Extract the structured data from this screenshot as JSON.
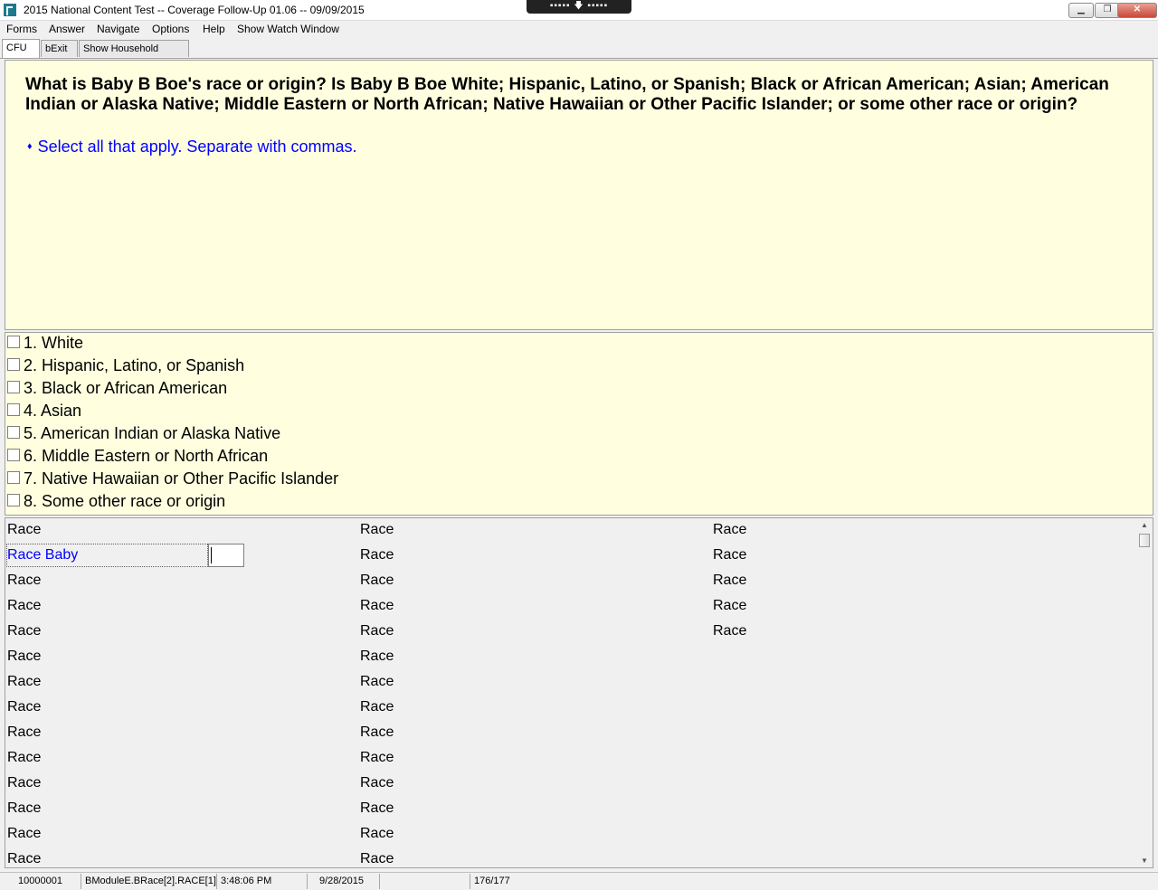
{
  "window": {
    "title": "2015 National Content Test -- Coverage Follow-Up 01.06 -- 09/09/2015",
    "toolbar_glyphs": "▪▪▪▪▪  🡇  ▪▪▪▪▪",
    "minimize_icon": "minimize-icon",
    "restore_icon": "restore-icon",
    "close_icon": "close-icon"
  },
  "menu": [
    "Forms",
    "Answer",
    "Navigate",
    "Options",
    "Help",
    "Show Watch Window"
  ],
  "tabs": [
    "CFU",
    "bExit",
    "Show Household Roster"
  ],
  "question": {
    "text": "What is Baby B Boe's race or origin? Is Baby B Boe White; Hispanic, Latino, or Spanish; Black or African American; Asian; American Indian or Alaska Native; Middle Eastern or North African; Native Hawaiian or Other Pacific Islander; or some other race or origin?",
    "bullet": "♦",
    "instruction": "Select all that apply. Separate with commas."
  },
  "options": [
    "1. White",
    "2. Hispanic, Latino, or Spanish",
    "3. Black or African American",
    "4. Asian",
    "5. American Indian or Alaska Native",
    "6. Middle Eastern or North African",
    "7. Native Hawaiian or Other Pacific Islander",
    "8. Some other race or origin"
  ],
  "grid": {
    "col1": [
      "Race",
      "Race Baby",
      "Race",
      "Race",
      "Race",
      "Race",
      "Race",
      "Race",
      "Race",
      "Race",
      "Race",
      "Race",
      "Race",
      "Race"
    ],
    "col2": [
      "Race",
      "Race",
      "Race",
      "Race",
      "Race",
      "Race",
      "Race",
      "Race",
      "Race",
      "Race",
      "Race",
      "Race",
      "Race",
      "Race"
    ],
    "col3": [
      "Race",
      "Race",
      "Race",
      "Race",
      "Race"
    ],
    "entry_value": ""
  },
  "status": {
    "case_id": "10000001",
    "field": "BModuleE.BRace[2].RACE[1]",
    "time": "3:48:06 PM",
    "date": "9/28/2015",
    "blank": "",
    "page": "176/177"
  }
}
